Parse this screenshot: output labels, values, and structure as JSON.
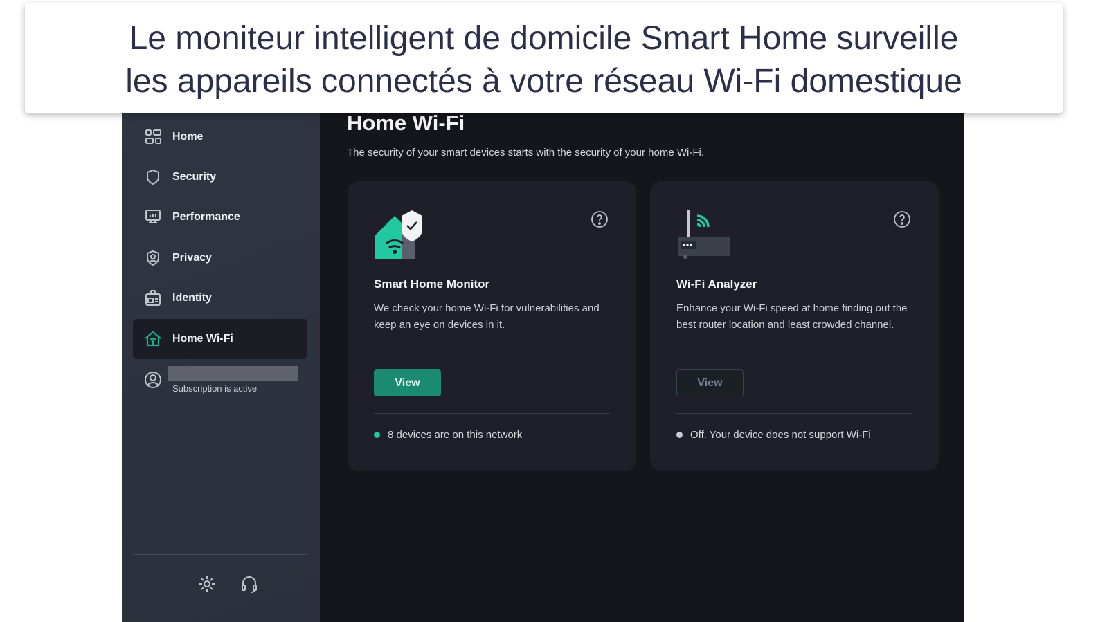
{
  "caption": {
    "line1": "Le moniteur intelligent de domicile Smart Home surveille",
    "line2": "les appareils connectés à votre réseau Wi-Fi domestique"
  },
  "sidebar": {
    "items": [
      {
        "label": "Home",
        "icon": "grid-icon"
      },
      {
        "label": "Security",
        "icon": "shield-icon"
      },
      {
        "label": "Performance",
        "icon": "monitor-icon"
      },
      {
        "label": "Privacy",
        "icon": "privacy-shield-icon"
      },
      {
        "label": "Identity",
        "icon": "id-badge-icon"
      },
      {
        "label": "Home Wi-Fi",
        "icon": "home-wifi-icon",
        "active": true
      }
    ],
    "subscription": "Subscription is active"
  },
  "main": {
    "title": "Home Wi-Fi",
    "subtitle": "The security of your smart devices starts with the security of your home Wi-Fi.",
    "cards": [
      {
        "title": "Smart Home Monitor",
        "description": "We check your home Wi-Fi for vulnerabilities and keep an eye on devices in it.",
        "button": "View",
        "status": "8 devices are on this network",
        "status_color": "#1fc79a"
      },
      {
        "title": "Wi-Fi Analyzer",
        "description": "Enhance your Wi-Fi speed at home finding out the best router location and least crowded channel.",
        "button": "View",
        "status": "Off. Your device does not support Wi-Fi",
        "status_color": "#c8cad0"
      }
    ]
  },
  "colors": {
    "accent": "#1a8a70"
  }
}
